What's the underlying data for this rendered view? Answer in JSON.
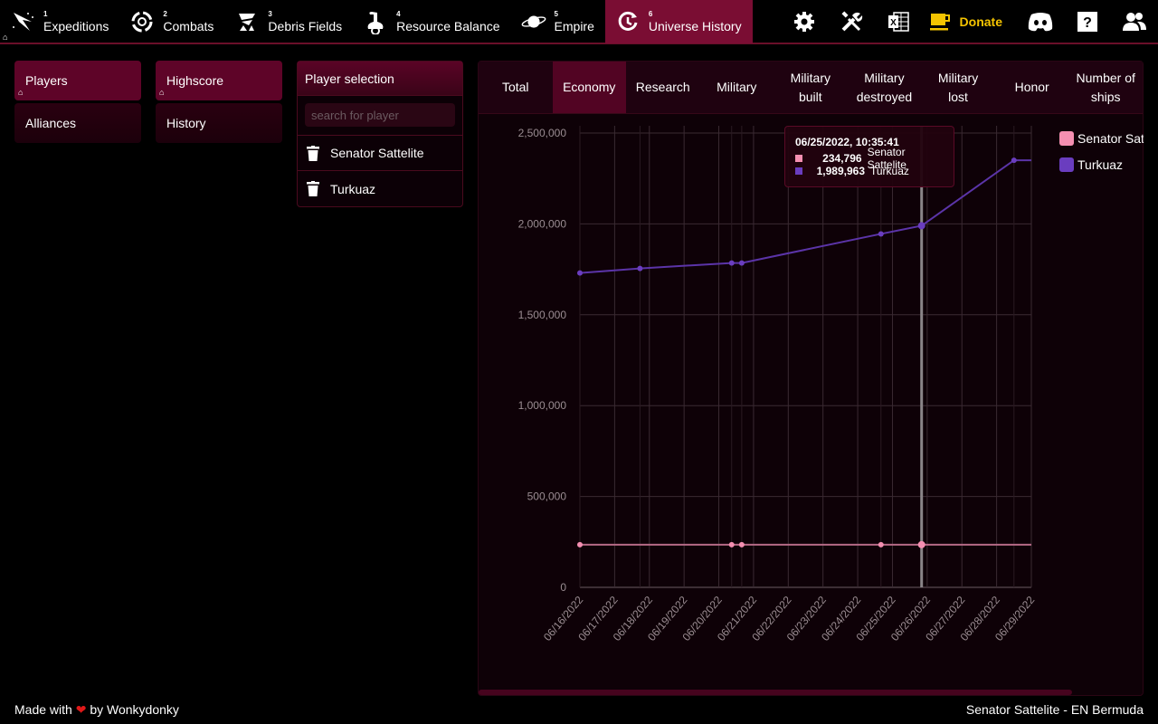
{
  "nav": {
    "items": [
      {
        "num": "1",
        "label": "Expeditions",
        "icon": "expedition-icon",
        "active": false
      },
      {
        "num": "2",
        "label": "Combats",
        "icon": "combat-icon",
        "active": false
      },
      {
        "num": "3",
        "label": "Debris Fields",
        "icon": "debris-icon",
        "active": false
      },
      {
        "num": "4",
        "label": "Resource Balance",
        "icon": "resource-icon",
        "active": false
      },
      {
        "num": "5",
        "label": "Empire",
        "icon": "planet-icon",
        "active": false
      },
      {
        "num": "6",
        "label": "Universe History",
        "icon": "history-icon",
        "active": true
      }
    ],
    "donate_label": "Donate",
    "right_icons": [
      "gear-icon",
      "tools-icon",
      "excel-icon",
      "cup-icon",
      "discord-icon",
      "help-icon",
      "users-icon"
    ]
  },
  "menu": {
    "col1": [
      {
        "label": "Players",
        "active": true
      },
      {
        "label": "Alliances",
        "active": false
      }
    ],
    "col2": [
      {
        "label": "Highscore",
        "active": true
      },
      {
        "label": "History",
        "active": false
      }
    ]
  },
  "player_selection": {
    "title": "Player selection",
    "search_placeholder": "search for player",
    "search_value": "",
    "players": [
      "Senator Sattelite",
      "Turkuaz"
    ]
  },
  "tabs": [
    {
      "label": "Total",
      "active": false
    },
    {
      "label": "Economy",
      "active": true
    },
    {
      "label": "Research",
      "active": false
    },
    {
      "label": "Military",
      "active": false
    },
    {
      "label": "Military built",
      "active": false
    },
    {
      "label": "Military destroyed",
      "active": false
    },
    {
      "label": "Military lost",
      "active": false
    },
    {
      "label": "Honor",
      "active": false
    },
    {
      "label": "Number of ships",
      "active": false
    }
  ],
  "tooltip": {
    "title": "06/25/2022, 10:35:41",
    "rows": [
      {
        "value": "234,796",
        "name": "Senator Sattelite",
        "color": "#f48fb1"
      },
      {
        "value": "1,989,963",
        "name": "Turkuaz",
        "color": "#6a3dbf"
      }
    ]
  },
  "chart_data": {
    "type": "line",
    "title": "",
    "xlabel": "",
    "ylabel": "",
    "ylim": [
      0,
      2500000
    ],
    "xlim": [
      "06/16/2022",
      "06/29/2022"
    ],
    "yticks": [
      "0",
      "500,000",
      "1,000,000",
      "1,500,000",
      "2,000,000",
      "2,500,000"
    ],
    "xticks": [
      "06/16/2022",
      "06/17/2022",
      "06/18/2022",
      "06/19/2022",
      "06/20/2022",
      "06/21/2022",
      "06/22/2022",
      "06/23/2022",
      "06/24/2022",
      "06/25/2022",
      "06/26/2022",
      "06/27/2022",
      "06/28/2022",
      "06/29/2022"
    ],
    "grid": true,
    "legend": "right",
    "hover_x_days": 9.84,
    "series": [
      {
        "name": "Senator Sattelite",
        "color": "#f48fb1",
        "x_days": [
          0,
          4.37,
          4.66,
          8.67,
          9.84,
          13
        ],
        "values": [
          234796,
          234796,
          234796,
          234796,
          234796,
          234796
        ],
        "markers": [
          true,
          true,
          true,
          true,
          true,
          false
        ]
      },
      {
        "name": "Turkuaz",
        "color": "#6a3dbf",
        "x_days": [
          0,
          1.73,
          4.37,
          4.66,
          8.67,
          9.84,
          12.5,
          13
        ],
        "values": [
          1730000,
          1755000,
          1785000,
          1785000,
          1945000,
          1989963,
          2350000,
          2350000
        ],
        "markers": [
          true,
          true,
          true,
          true,
          true,
          true,
          true,
          false
        ]
      }
    ]
  },
  "footer": {
    "made_with": "Made with",
    "by": "by Wonkydonky",
    "right": "Senator Sattelite - EN Bermuda"
  }
}
